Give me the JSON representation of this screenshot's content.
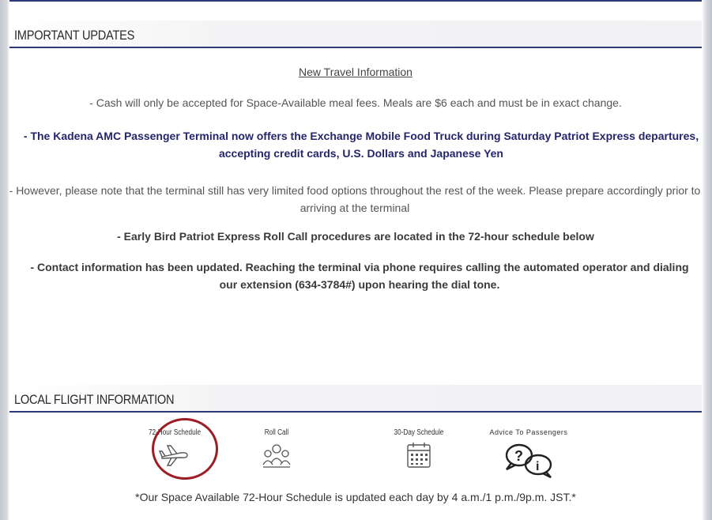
{
  "updates": {
    "title": "IMPORTANT UPDATES",
    "heading": "New Travel Information",
    "items": [
      "- Cash will only be accepted for Space-Available meal fees. Meals are $6 each and must be in exact change.",
      "- The Kadena AMC Passenger Terminal now offers the Exchange Mobile Food Truck during Saturday Patriot Express departures, accepting credit cards, U.S. Dollars and Japanese Yen",
      "- However, please note that the terminal still has very limited food options throughout the rest of the week. Please prepare accordingly prior to arriving at the terminal",
      "- Early Bird Patriot Express Roll Call procedures are located in the 72-hour schedule below",
      "- Contact information has been updated. Reaching the terminal via phone requires calling the automated operator and dialing our extension (634-3784#) upon hearing the dial tone."
    ]
  },
  "flights": {
    "title": "LOCAL FLIGHT INFORMATION",
    "tiles": [
      {
        "label": "72-Hour Schedule",
        "icon": "airplane-icon"
      },
      {
        "label": "Roll Call",
        "icon": "people-icon"
      },
      {
        "label": "30-Day Schedule",
        "icon": "calendar-icon"
      },
      {
        "label": "Advice To Passengers",
        "icon": "question-info-bubbles-icon"
      }
    ],
    "footnote": "*Our Space Available 72-Hour Schedule is updated each day by 4 a.m./1 p.m./9p.m. JST.*"
  },
  "colors": {
    "accent": "#2f3a78",
    "highlight_circle": "#9e1c24",
    "navy_text": "#23266b"
  }
}
